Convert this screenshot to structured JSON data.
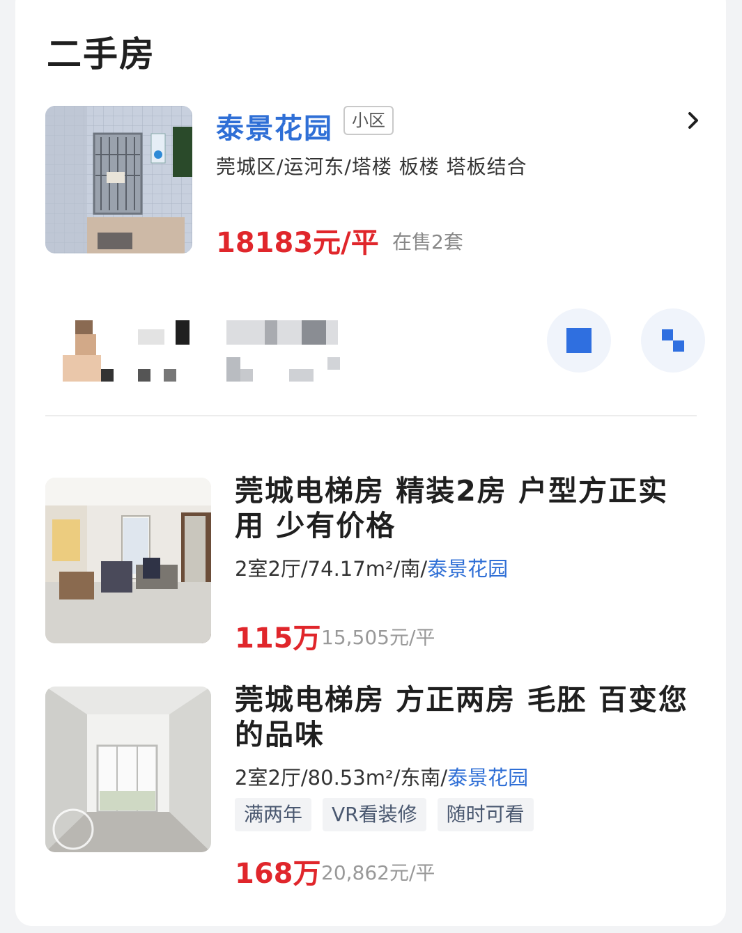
{
  "section": {
    "title": "二手房"
  },
  "community": {
    "name": "泰景花园",
    "tag": "小区",
    "location": "莞城区/运河东/塔楼 板楼 塔板结合",
    "price": "18183元/平",
    "on_sale": "在售2套",
    "icons": {
      "arrow": "chevron-right-icon"
    }
  },
  "agent": {
    "note": "blurred agent info",
    "icons": {
      "chat": "chat-icon",
      "phone": "phone-icon"
    }
  },
  "listings": [
    {
      "title": "莞城电梯房 精装2房 户型方正实用 少有价格",
      "spec_prefix": "2室2厅/74.17m²/南/",
      "community_link": "泰景花园",
      "tags": [],
      "total_price": "115万",
      "unit_price": "15,505元/平"
    },
    {
      "title": "莞城电梯房 方正两房 毛胚 百变您的品味",
      "spec_prefix": "2室2厅/80.53m²/东南/",
      "community_link": "泰景花园",
      "tags": [
        "满两年",
        "VR看装修",
        "随时可看"
      ],
      "total_price": "168万",
      "unit_price": "20,862元/平"
    }
  ],
  "colors": {
    "brand_blue": "#2f6fd6",
    "price_red": "#e0262b"
  }
}
